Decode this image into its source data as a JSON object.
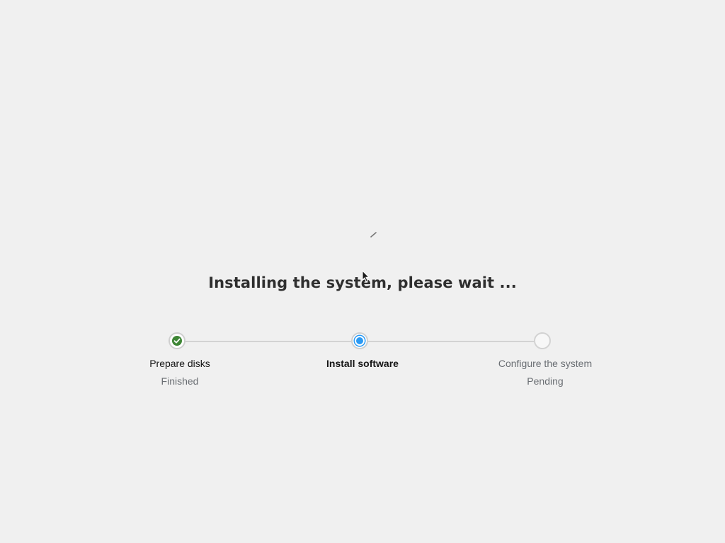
{
  "title": "Installing the system, please wait ...",
  "spinner_icon": "loading-spinner-icon",
  "colors": {
    "finished": "#3e8635",
    "current": "#2b9af3",
    "connector": "#d3d3d3",
    "background": "#f0f0f0"
  },
  "steps": [
    {
      "label": "Prepare disks",
      "status": "Finished",
      "state": "finished",
      "icon": "check-icon"
    },
    {
      "label": "Install software",
      "status": "",
      "state": "current",
      "icon": "current-step-dot-icon"
    },
    {
      "label": "Configure the system",
      "status": "Pending",
      "state": "pending",
      "icon": "pending-step-icon"
    }
  ]
}
